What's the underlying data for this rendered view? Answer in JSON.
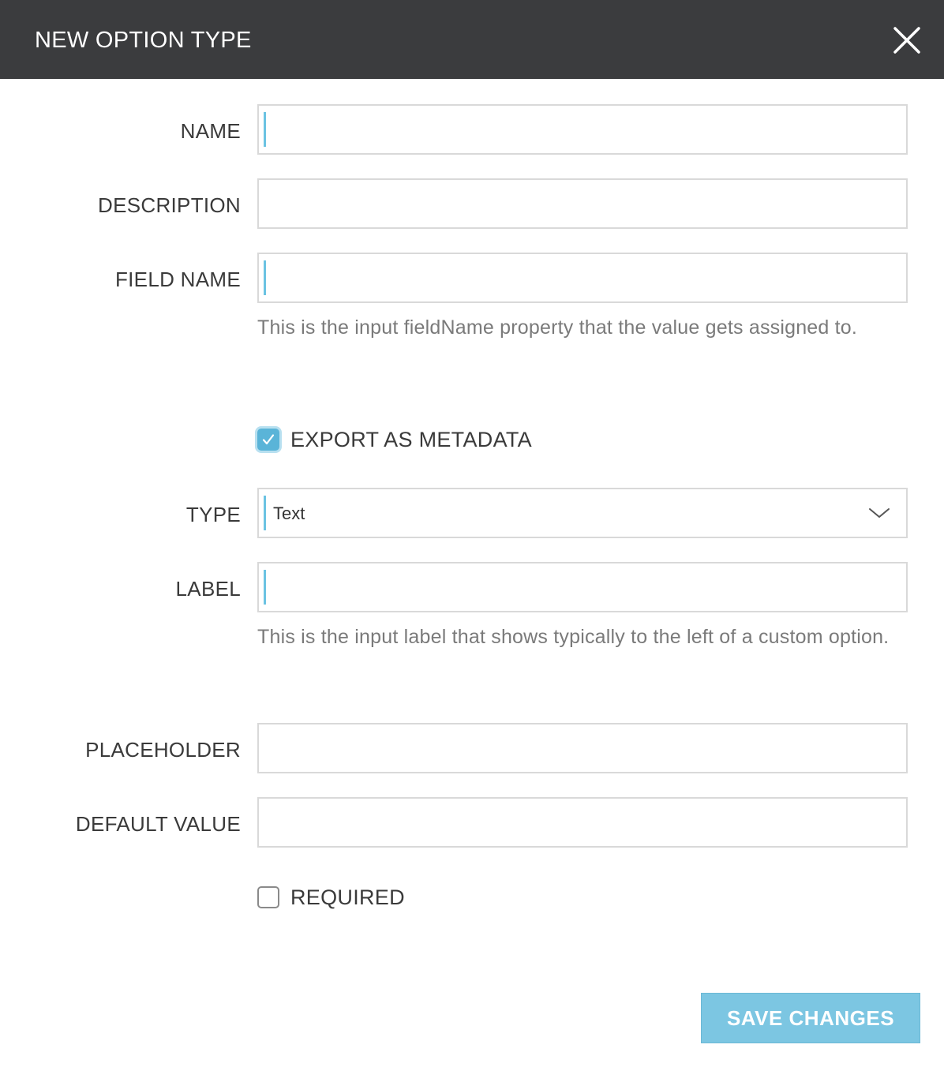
{
  "dialog": {
    "title": "NEW OPTION TYPE",
    "close_icon": "close-icon"
  },
  "fields": {
    "name": {
      "label": "NAME",
      "value": "",
      "placeholder": ""
    },
    "description": {
      "label": "DESCRIPTION",
      "value": "",
      "placeholder": ""
    },
    "field_name": {
      "label": "FIELD NAME",
      "value": "",
      "placeholder": "",
      "help": "This is the input fieldName property that the value gets assigned to."
    },
    "export_as_metadata": {
      "label": "EXPORT AS METADATA",
      "checked": true
    },
    "type": {
      "label": "TYPE",
      "selected": "Text"
    },
    "label": {
      "label": "LABEL",
      "value": "",
      "placeholder": "",
      "help": "This is the input label that shows typically to the left of a custom option."
    },
    "placeholder": {
      "label": "PLACEHOLDER",
      "value": "",
      "placeholder": ""
    },
    "default_value": {
      "label": "DEFAULT VALUE",
      "value": "",
      "placeholder": ""
    },
    "required": {
      "label": "REQUIRED",
      "checked": false
    }
  },
  "footer": {
    "save_label": "SAVE CHANGES"
  },
  "colors": {
    "header_bg": "#3b3c3e",
    "accent": "#5ab4d8",
    "button_bg": "#7cc6e2"
  }
}
